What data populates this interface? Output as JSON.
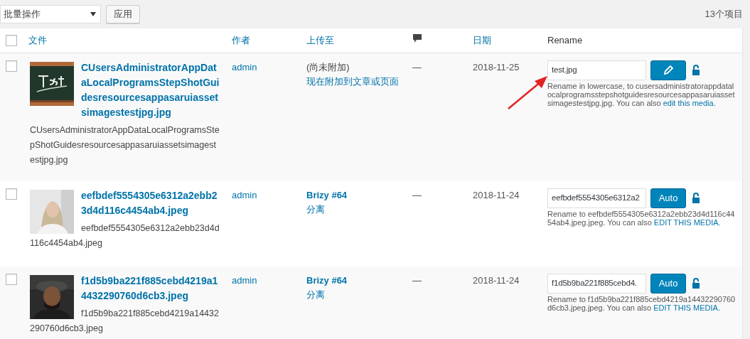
{
  "toolbar": {
    "bulk_action": "批量操作",
    "apply_button": "应用",
    "item_count": "13个项目"
  },
  "header": {
    "checked": false,
    "columns": [
      {
        "kind": "link",
        "label": "文件"
      },
      {
        "kind": "link",
        "label": "作者"
      },
      {
        "kind": "link",
        "label": "上传至"
      },
      {
        "kind": "comment"
      },
      {
        "kind": "link",
        "label": "日期"
      },
      {
        "kind": "text",
        "label": "Rename"
      }
    ]
  },
  "rows": [
    {
      "checked": false,
      "title": "CUsersAdministratorAppDataLocalProgramsStepShotGuidesresourcesappasaruiassetsimagestestjpg.jpg",
      "file_name": "CUsersAdministratorAppDataLocalProgramsStepShotGuidesresourcesappasaruiassetsimagestestjpg.jpg",
      "author": "admin",
      "uploaded_to": {
        "kind": "unattached",
        "status": "(尚未附加)",
        "action": "现在附加到文章或页面"
      },
      "comments": "—",
      "date": "2018-11-25",
      "rename": {
        "value": "test.jpg",
        "button": {
          "kind": "edit"
        },
        "hint": "Rename in lowercase, to cusersadministratorappdatalocalprogramsstepshotguidesresourcesappasaruiassetsimagestestjpg.jpg. You can also ",
        "hint_link": "edit this media."
      }
    },
    {
      "checked": false,
      "title": "eefbdef5554305e6312a2ebb23d4d116c4454ab4.jpeg",
      "file_name": "eefbdef5554305e6312a2ebb23d4d116c4454ab4.jpeg",
      "author": "admin",
      "uploaded_to": {
        "kind": "attached",
        "status": "Brizy #64",
        "action": "分离"
      },
      "comments": "—",
      "date": "2018-11-24",
      "rename": {
        "value": "eefbdef5554305e6312a2",
        "button": {
          "kind": "text",
          "label": "Auto"
        },
        "hint": "Rename to eefbdef5554305e6312a2ebb23d4d116c4454ab4.jpeg.jpeg. You can also ",
        "hint_link": "EDIT THIS MEDIA."
      }
    },
    {
      "checked": false,
      "title": "f1d5b9ba221f885cebd4219a14432290760d6cb3.jpeg",
      "file_name": "f1d5b9ba221f885cebd4219a14432290760d6cb3.jpeg",
      "author": "admin",
      "uploaded_to": {
        "kind": "attached",
        "status": "Brizy #64",
        "action": "分离"
      },
      "comments": "—",
      "date": "2018-11-24",
      "rename": {
        "value": "f1d5b9ba221f885cebd4.",
        "button": {
          "kind": "text",
          "label": "Auto"
        },
        "hint": "Rename to f1d5b9ba221f885cebd4219a14432290760d6cb3.jpeg.jpeg. You can also ",
        "hint_link": "EDIT THIS MEDIA."
      }
    }
  ]
}
